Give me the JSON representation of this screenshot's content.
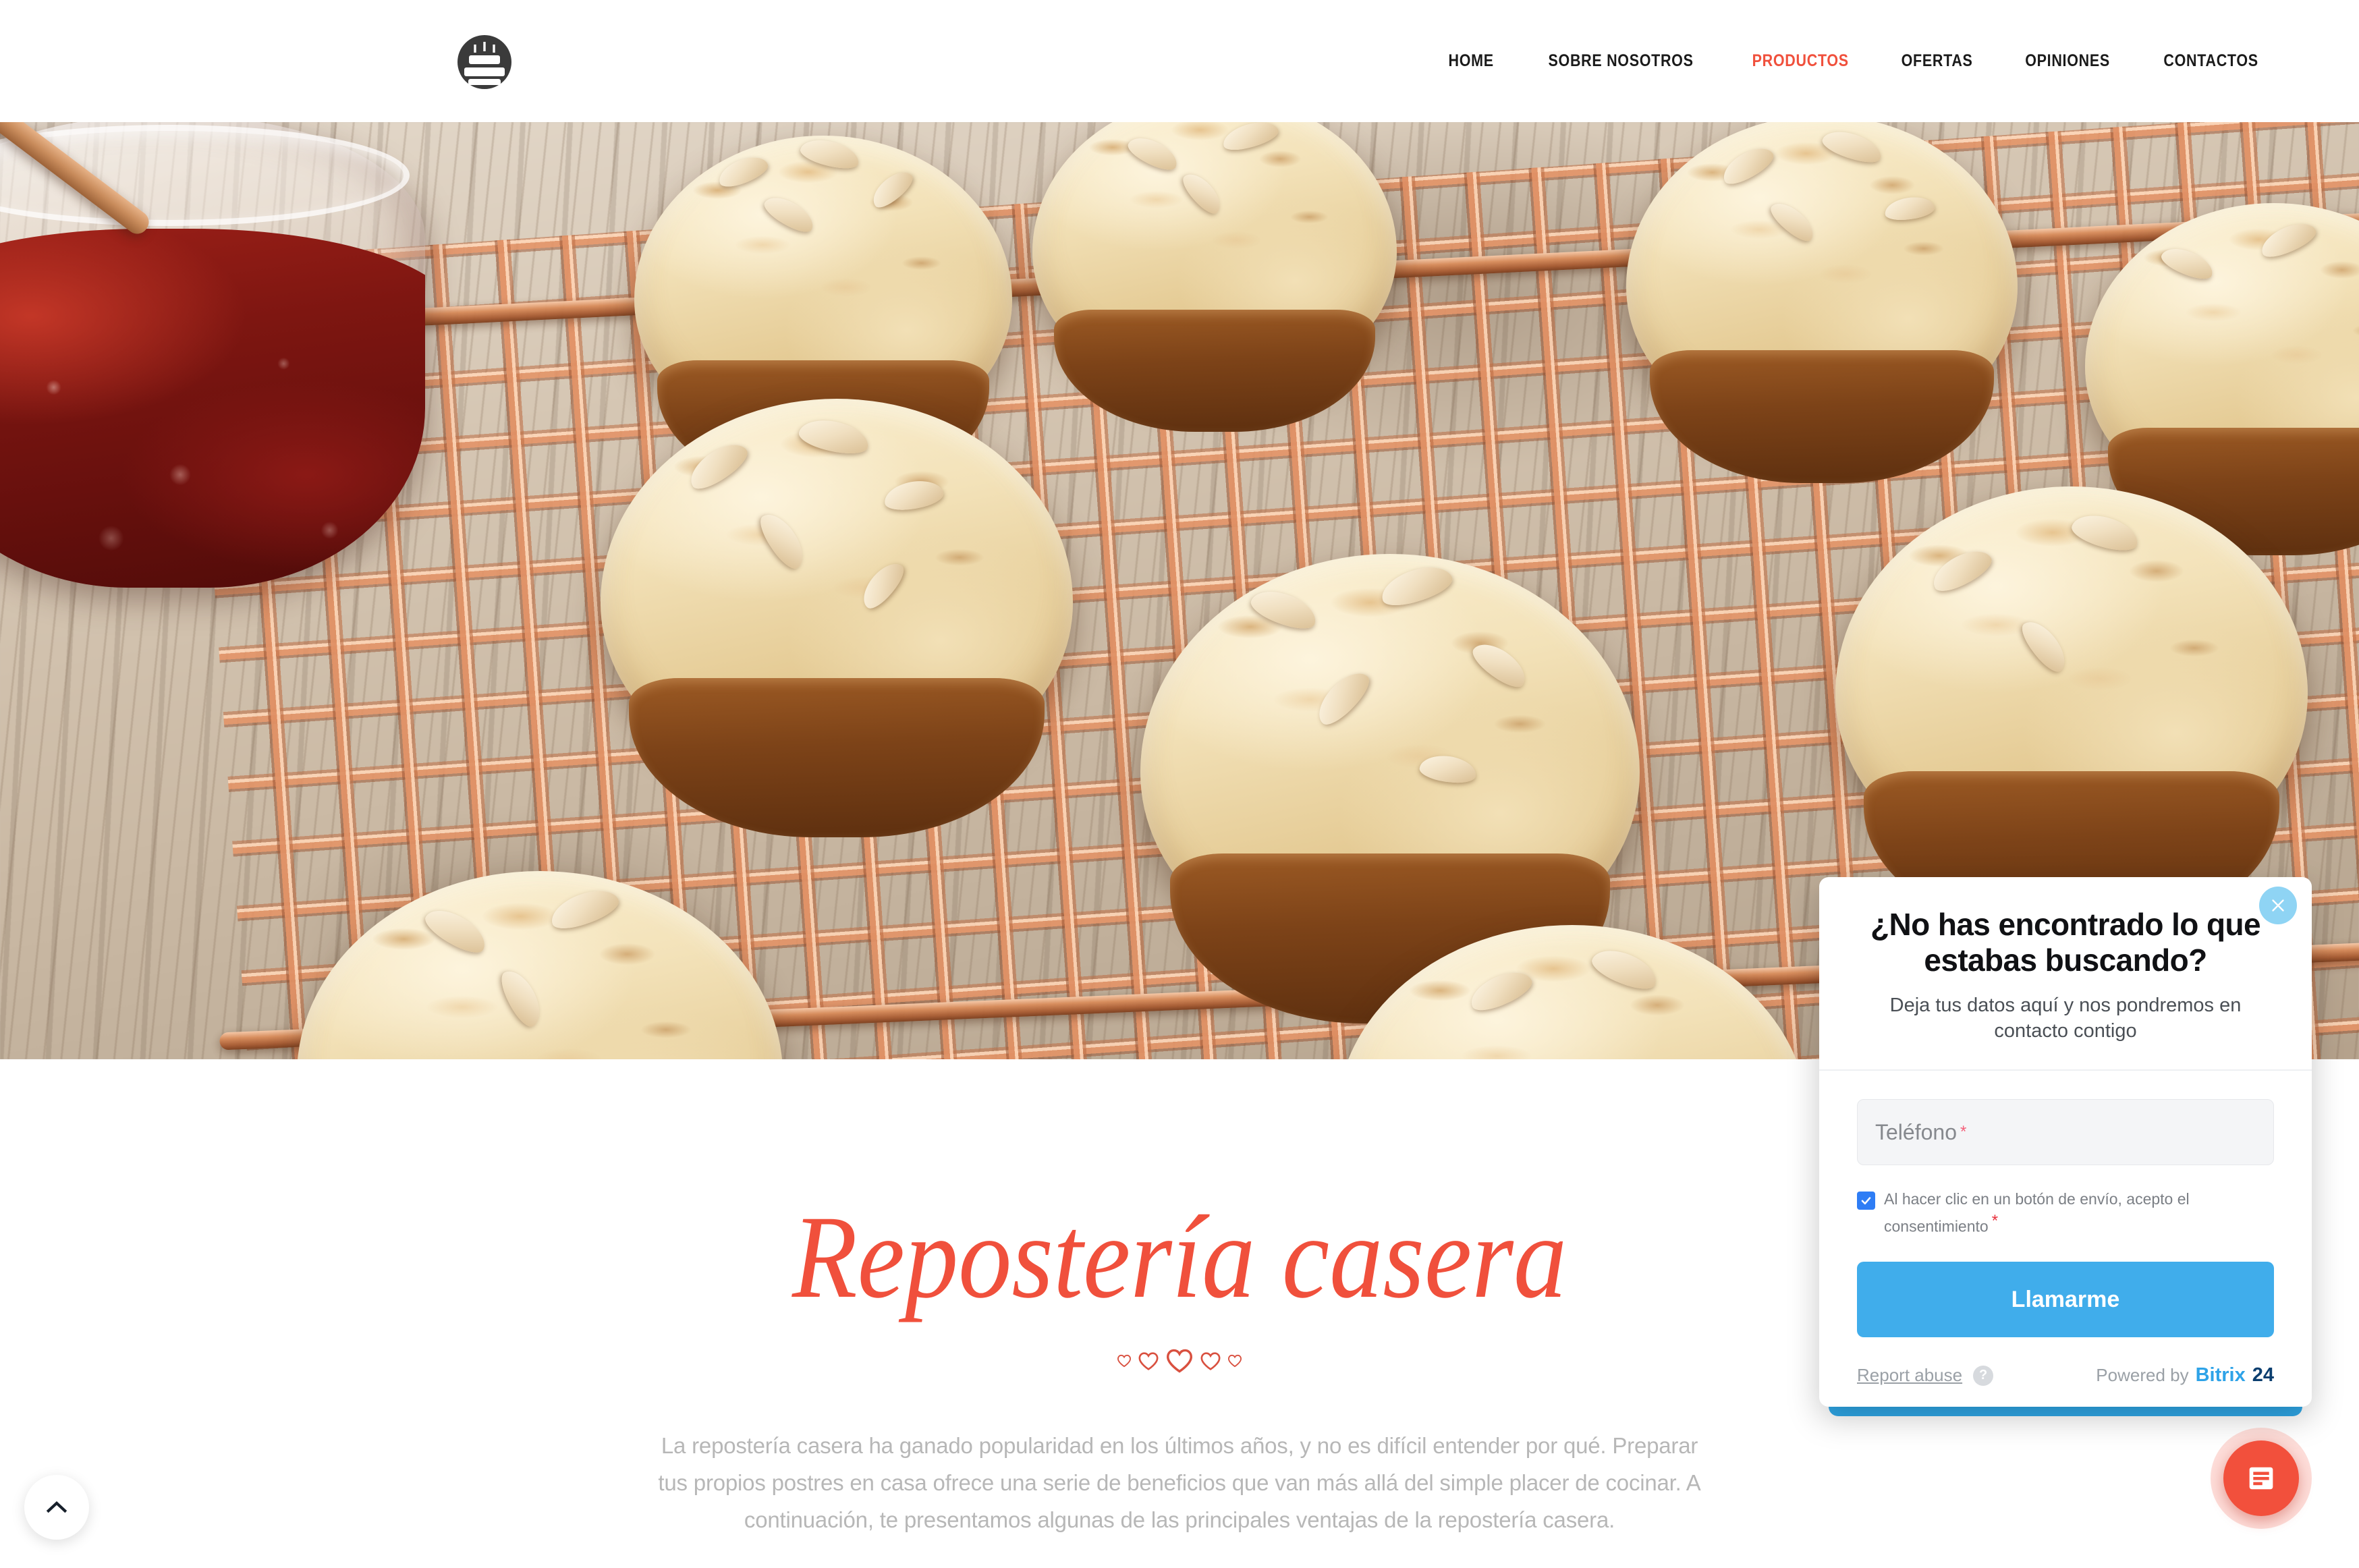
{
  "header": {
    "logo_icon": "cake-logo-icon",
    "nav": [
      {
        "label": "HOME",
        "active": false
      },
      {
        "label": "SOBRE NOSOTROS",
        "active": false
      },
      {
        "label": "PRODUCTOS",
        "active": true
      },
      {
        "label": "OFERTAS",
        "active": false
      },
      {
        "label": "OPINIONES",
        "active": false
      },
      {
        "label": "CONTACTOS",
        "active": false
      }
    ],
    "accent_color": "#f0503c"
  },
  "hero": {
    "alt": "Muffins de almendra sobre rejilla de cobre junto a un tarro de mermelada"
  },
  "main": {
    "title": "Repostería casera",
    "divider_icon": "hearts-divider-icon",
    "paragraph": "La repostería casera ha ganado popularidad en los últimos años, y no es difícil entender por qué. Preparar tus propios postres en casa ofrece una serie de beneficios que van más allá del simple placer de cocinar. A continuación, te presentamos algunas de las principales ventajas de la repostería casera.",
    "title_color": "#f0503c",
    "text_color": "#b7b7b7"
  },
  "popup": {
    "title": "¿No has encontrado lo que estabas buscando?",
    "subtitle": "Deja tus datos aquí y nos pondremos en contacto contigo",
    "close_icon": "close-icon",
    "phone_field": {
      "placeholder": "Teléfono",
      "value": "",
      "required_mark": "*"
    },
    "consent": {
      "checked": true,
      "text": "Al hacer clic en un botón de envío, acepto el consentimiento",
      "required_mark": "*"
    },
    "submit_label": "Llamarme",
    "report_abuse": "Report abuse",
    "help_icon": "question-mark-icon",
    "powered_by": "Powered by",
    "brand_primary": "Bitrix",
    "brand_secondary": "24",
    "accent_color": "#40adeb"
  },
  "floating": {
    "scroll_top_icon": "chevron-up-icon",
    "chat_icon": "form-lines-icon",
    "chat_color": "#f2503c"
  }
}
